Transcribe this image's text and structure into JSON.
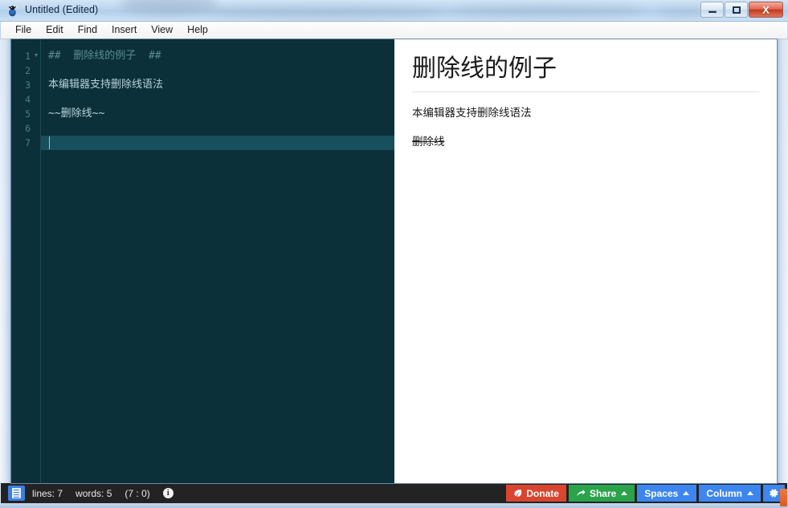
{
  "window": {
    "title": "Untitled (Edited)",
    "app_icon": "bug-icon",
    "controls": {
      "minimize": "minimize-button",
      "maximize": "maximize-button",
      "close_label": "X"
    }
  },
  "menu": {
    "items": [
      {
        "label": "File"
      },
      {
        "label": "Edit"
      },
      {
        "label": "Find"
      },
      {
        "label": "Insert"
      },
      {
        "label": "View"
      },
      {
        "label": "Help"
      }
    ]
  },
  "editor": {
    "lines": [
      {
        "number": "1",
        "text": "##  删除线的例子  ##",
        "style": "heading",
        "fold": true
      },
      {
        "number": "2",
        "text": "",
        "style": "body",
        "fold": false
      },
      {
        "number": "3",
        "text": "本编辑器支持删除线语法",
        "style": "body",
        "fold": false
      },
      {
        "number": "4",
        "text": "",
        "style": "body",
        "fold": false
      },
      {
        "number": "5",
        "text": "~~删除线~~",
        "style": "body",
        "fold": false
      },
      {
        "number": "6",
        "text": "",
        "style": "body",
        "fold": false
      },
      {
        "number": "7",
        "text": "",
        "style": "body",
        "fold": false
      }
    ],
    "current_line": 7,
    "background_color": "#0b3039",
    "current_line_color": "#17505c",
    "heading_text_color": "#5d8b93",
    "body_text_color": "#b9d2d8",
    "gutter_text_color": "#4c7f88"
  },
  "preview": {
    "heading": "删除线的例子",
    "paragraph": "本编辑器支持删除线语法",
    "strikethrough": "删除线"
  },
  "statusbar": {
    "doc_icon": "document-lines-icon",
    "lines": "lines: 7",
    "words": "words: 5",
    "position": "(7 : 0)",
    "info_icon": "info-icon",
    "buttons": {
      "donate": {
        "label": "Donate",
        "icon": "leaf-icon",
        "color": "#d9452e"
      },
      "share": {
        "label": "Share",
        "icon": "arrow-up-right-icon",
        "color": "#2aa34a"
      },
      "spaces": {
        "label": "Spaces",
        "color": "#3d86f0"
      },
      "column": {
        "label": "Column",
        "color": "#3d86f0"
      },
      "settings": {
        "icon": "gear-icon",
        "color": "#3d86f0"
      }
    }
  }
}
